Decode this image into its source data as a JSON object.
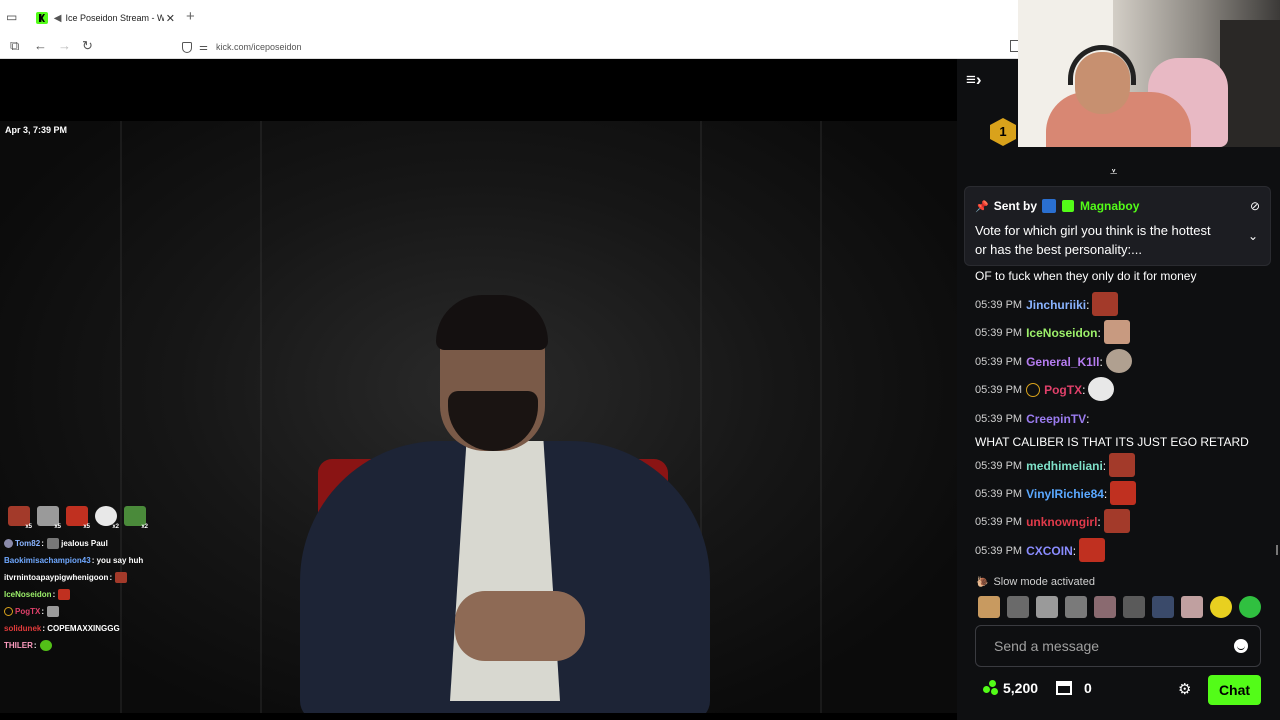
{
  "browser": {
    "tab_title": "Ice Poseidon Stream - Watc",
    "new_tab": "+",
    "url": "kick.com/iceposeidon"
  },
  "video": {
    "timestamp": "Apr 3, 7:39 PM"
  },
  "overlay": {
    "emote_counts": [
      "x5",
      "x5",
      "x5",
      "x2",
      "x2"
    ],
    "lines": [
      {
        "user": "Tom82",
        "sep": ":",
        "text": "jealous Paul",
        "color": "#8ab4ff"
      },
      {
        "user": "Baokimisachampion43",
        "sep": ":",
        "text": "you say huh",
        "color": "#6fa8ff"
      },
      {
        "user": "itvrnintoapaypigwhenigoon",
        "sep": ":",
        "text": "",
        "color": "#ffffff"
      },
      {
        "user": "IceNoseidon",
        "sep": ":",
        "text": "",
        "color": "#9cf06a"
      },
      {
        "user": "PogTX",
        "sep": ":",
        "text": "",
        "color": "#e0406a"
      },
      {
        "user": "solidunek",
        "sep": ":",
        "text": "COPEMAXXINGGG",
        "color": "#e03a3a"
      },
      {
        "user": "THILER",
        "sep": ":",
        "text": "",
        "color": "#ff9cc0"
      }
    ]
  },
  "chat": {
    "leader_rank": "1",
    "pinned": {
      "sent_by_label": "Sent by",
      "user": "Magnaboy",
      "message": "Vote for which girl you think is the hottest or has the best personality:..."
    },
    "continued_text": "OF to fuck when they only do it for money",
    "messages": [
      {
        "time": "05:39 PM",
        "user": "Jinchuriiki",
        "sep": ":",
        "text": "",
        "color": "#8ab4ff",
        "emote": "#a33a2a"
      },
      {
        "time": "05:39 PM",
        "user": "IceNoseidon",
        "sep": ":",
        "text": "",
        "color": "#9cf06a",
        "emote": "#c89a80"
      },
      {
        "time": "05:39 PM",
        "user": "General_K1ll",
        "sep": ":",
        "text": "",
        "color": "#b57cf0",
        "emote": "#b0a090"
      },
      {
        "time": "05:39 PM",
        "user": "PogTX",
        "sep": ":",
        "text": "",
        "color": "#e0406a",
        "emote": "#e8e8e8",
        "badge": true
      },
      {
        "time": "05:39 PM",
        "user": "CreepinTV",
        "sep": ":",
        "text": " WHAT CALIBER IS THAT ITS JUST EGO RETARD",
        "color": "#9b7cf0",
        "emote": ""
      },
      {
        "time": "05:39 PM",
        "user": "medhimeliani",
        "sep": ":",
        "text": "",
        "color": "#7fe0c8",
        "emote": "#a33a2a"
      },
      {
        "time": "05:39 PM",
        "user": "VinylRichie84",
        "sep": ":",
        "text": "",
        "color": "#5aa8ff",
        "emote": "#c03020"
      },
      {
        "time": "05:39 PM",
        "user": "unknowngirl",
        "sep": ":",
        "text": "",
        "color": "#e03a4a",
        "emote": "#a33a2a"
      },
      {
        "time": "05:39 PM",
        "user": "CXCOIN",
        "sep": ":",
        "text": "",
        "color": "#8a8cff",
        "emote": "#c03020"
      }
    ],
    "slow_mode": "Slow mode activated",
    "send_placeholder": "Send a message",
    "coins": "5,200",
    "store_count": "0",
    "chat_button": "Chat"
  },
  "colors": {
    "brand": "#53fc18",
    "panel_bg": "#0e0f11"
  }
}
